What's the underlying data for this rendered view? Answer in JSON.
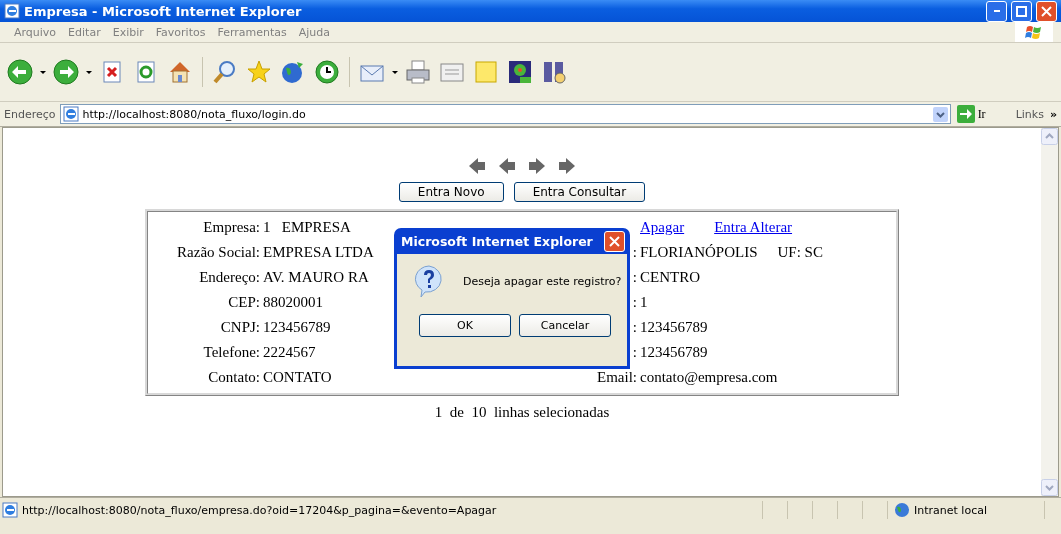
{
  "window": {
    "title": "Empresa - Microsoft Internet Explorer"
  },
  "menu": [
    "Arquivo",
    "Editar",
    "Exibir",
    "Favoritos",
    "Ferramentas",
    "Ajuda"
  ],
  "address": {
    "label": "Endereço",
    "value": "http://localhost:8080/nota_fluxo/login.do",
    "go": "Ir",
    "links": "Links",
    "more": "»"
  },
  "page": {
    "buttons": [
      "Entra Novo",
      "Entra Consultar"
    ],
    "rows": [
      {
        "label": "Empresa:",
        "value": "1   EMPRESA",
        "links": [
          "Apagar",
          "Entra Alterar"
        ]
      },
      {
        "label": "Razão Social:",
        "value": "EMPRESA LTDA",
        "right_label": ":",
        "right_value": "FLORIANÓPOLIS",
        "extra": "UF: SC"
      },
      {
        "label": "Endereço:",
        "value": "AV. MAURO RA",
        "right_label": ":",
        "right_value": "CENTRO"
      },
      {
        "label": "CEP:",
        "value": "88020001",
        "right_label": ":",
        "right_value": "1"
      },
      {
        "label": "CNPJ:",
        "value": "123456789",
        "right_label": ":",
        "right_value": "123456789"
      },
      {
        "label": "Telefone:",
        "value": "2224567",
        "right_label": ":",
        "right_value": "123456789"
      },
      {
        "label": "Contato:",
        "value": "CONTATO",
        "right_label": "Email:",
        "right_value": "contato@empresa.com"
      }
    ],
    "pagination": "1  de  10  linhas selecionadas"
  },
  "dialog": {
    "title": "Microsoft Internet Explorer",
    "message": "Deseja apagar este registro?",
    "buttons": [
      "OK",
      "Cancelar"
    ]
  },
  "status_bar": {
    "url": "http://localhost:8080/nota_fluxo/empresa.do?oid=17204&p_pagina=&evento=Apagar",
    "zone": "Intranet local"
  }
}
